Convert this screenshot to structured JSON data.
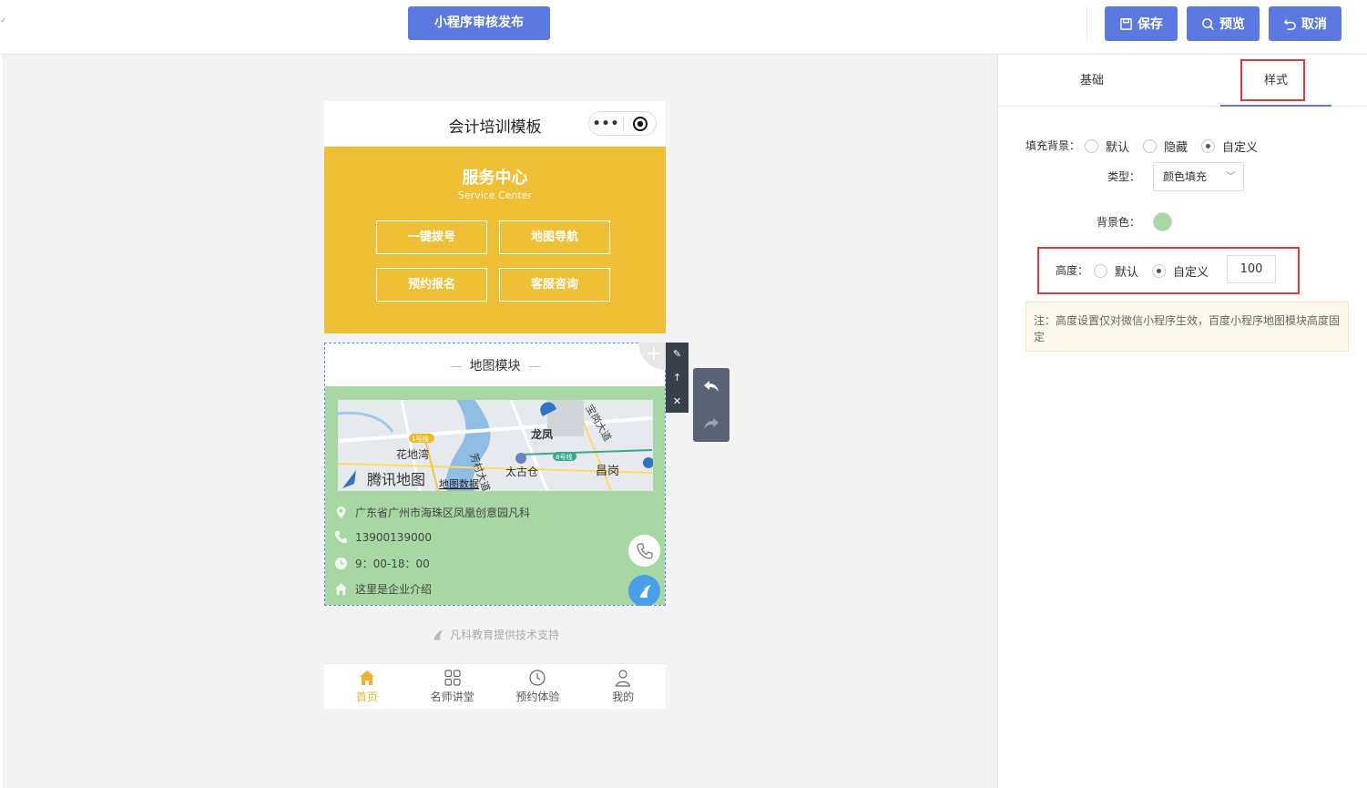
{
  "toolbar": {
    "publish_label": "小程序审核发布",
    "save_label": "保存",
    "preview_label": "预览",
    "cancel_label": "取消",
    "accent_color": "#5b79e0"
  },
  "phone": {
    "title": "会计培训模板",
    "capsule_more": "•••"
  },
  "service": {
    "title": "服务中心",
    "subtitle": "Service Center",
    "background": "#efc035",
    "buttons": [
      "一键拨号",
      "地图导航",
      "预约报名",
      "客服咨询"
    ]
  },
  "map_module": {
    "title": "地图模块",
    "background": "#a7d7a3",
    "map_labels": {
      "line1": "1号线",
      "huadiwan": "花地湾",
      "fangcun": "芳村大道",
      "longfeng": "龙凤",
      "baoye": "宝岗大道",
      "line8": "8号线",
      "taiguchang": "太古仓",
      "changgang": "昌岗",
      "tencent": "腾讯地图",
      "mapdata": "地图数据"
    },
    "address": "广东省广州市海珠区凤凰创意园凡科",
    "phone": "13900139000",
    "hours": "9：00-18：00",
    "intro": "这里是企业介绍"
  },
  "powered_by": "凡科教育提供技术支持",
  "tabbar": [
    {
      "label": "首页",
      "icon": "home-icon"
    },
    {
      "label": "名师讲堂",
      "icon": "grid-icon"
    },
    {
      "label": "预约体验",
      "icon": "clock-icon"
    },
    {
      "label": "我的",
      "icon": "user-icon"
    }
  ],
  "panel": {
    "tabs": [
      "基础",
      "样式"
    ],
    "fill_bg_label": "填充背景：",
    "fill_options": [
      "默认",
      "隐藏",
      "自定义"
    ],
    "type_label": "类型：",
    "type_value": "颜色填充",
    "bg_color_label": "背景色：",
    "bg_color": "#a7d7a3",
    "height_label": "高度：",
    "height_options": [
      "默认",
      "自定义"
    ],
    "height_value": "100",
    "note": "注：高度设置仅对微信小程序生效，百度小程序地图模块高度固定"
  }
}
